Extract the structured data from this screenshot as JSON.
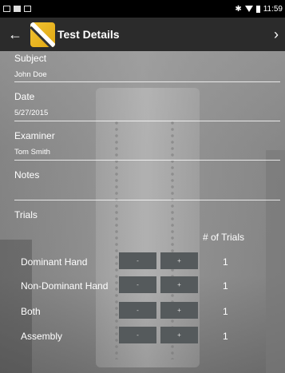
{
  "status_bar": {
    "time": "11:59",
    "icons": [
      "screen-icon",
      "sd-card-icon",
      "photo-icon"
    ],
    "right_icons": [
      "bluetooth-icon",
      "wifi-icon",
      "battery-icon"
    ]
  },
  "app_bar": {
    "back_icon": "back-arrow-icon",
    "title": "Test Details",
    "forward_icon": "chevron-right-icon"
  },
  "form": {
    "subject": {
      "label": "Subject",
      "value": "John Doe"
    },
    "date": {
      "label": "Date",
      "value": "5/27/2015"
    },
    "examiner": {
      "label": "Examiner",
      "value": "Tom Smith"
    },
    "notes": {
      "label": "Notes",
      "value": ""
    },
    "trials_label": "Trials",
    "trials_header": "# of Trials"
  },
  "trials": [
    {
      "label": "Dominant Hand",
      "minus": "-",
      "plus": "+",
      "count": "1"
    },
    {
      "label": "Non-Dominant Hand",
      "minus": "-",
      "plus": "+",
      "count": "1"
    },
    {
      "label": "Both",
      "minus": "-",
      "plus": "+",
      "count": "1"
    },
    {
      "label": "Assembly",
      "minus": "-",
      "plus": "+",
      "count": "1"
    }
  ],
  "colors": {
    "status_bar": "#000000",
    "app_bar": "#2b2b2b",
    "button": "#555a5c",
    "logo": "#f1c232"
  }
}
